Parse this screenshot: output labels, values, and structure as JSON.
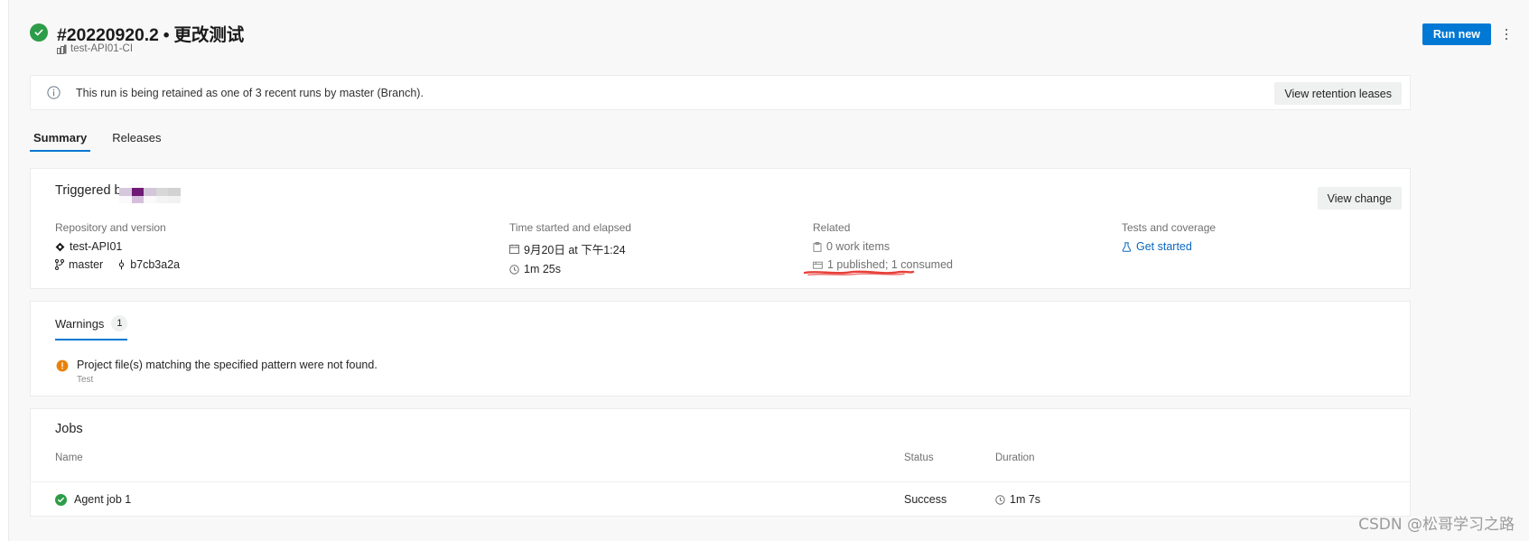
{
  "header": {
    "status_icon": "success-check-icon",
    "run_number": "#20220920.2",
    "separator": "•",
    "run_name": "更改测试",
    "pipeline_name": "test-API01-CI",
    "pipeline_icon": "pipeline-icon",
    "run_new_label": "Run new",
    "more_actions_icon": "kebab-menu-icon"
  },
  "banner": {
    "icon": "info-icon",
    "message": "This run is being retained as one of 3 recent runs by master (Branch).",
    "action_label": "View retention leases"
  },
  "tabs": [
    {
      "label": "Summary",
      "active": true
    },
    {
      "label": "Releases",
      "active": false
    }
  ],
  "summary": {
    "triggered_by_label": "Triggered b",
    "triggered_by_value_redacted": "█████",
    "view_change_label": "View change",
    "columns": [
      {
        "heading": "Repository and version",
        "lines": [
          {
            "icon": "repository-icon",
            "text": "test-API01"
          }
        ],
        "inline": [
          {
            "icon": "branch-icon",
            "text": "master"
          },
          {
            "icon": "commit-icon",
            "text": "b7cb3a2a"
          }
        ]
      },
      {
        "heading": "Time started and elapsed",
        "lines": [
          {
            "icon": "calendar-icon",
            "text": "9月20日 at 下午1:24"
          },
          {
            "icon": "clock-icon",
            "text": "1m 25s"
          }
        ]
      },
      {
        "heading": "Related",
        "lines": [
          {
            "icon": "work-item-icon",
            "text": "0 work items"
          },
          {
            "icon": "artifact-icon",
            "text": "1 published; 1 consumed"
          }
        ]
      },
      {
        "heading": "Tests and coverage",
        "lines": [
          {
            "icon": "tests-icon",
            "text": "Get started"
          }
        ]
      }
    ]
  },
  "annotation": {
    "type": "red-underline",
    "color": "#e8403a",
    "targets": "1 published; 1 consumed"
  },
  "warnings": {
    "tab_label": "Warnings",
    "count": "1",
    "icon": "warning-icon",
    "message": "Project file(s) matching the specified pattern were not found.",
    "source": "Test"
  },
  "jobs": {
    "title": "Jobs",
    "columns": [
      "Name",
      "Status",
      "Duration"
    ],
    "rows": [
      {
        "icon": "success-check-icon",
        "name": "Agent job 1",
        "status": "Success",
        "duration_icon": "clock-icon",
        "duration": "1m 7s"
      }
    ]
  },
  "watermark": {
    "text": "CSDN @松哥学习之路"
  },
  "colors": {
    "accent": "#0078d4",
    "success": "#2d9c48",
    "warning": "#e8810c",
    "link": "#0a67c2",
    "annotation_red": "#e8403a",
    "card_bg": "#ffffff",
    "page_bg": "#f8f8f8"
  }
}
